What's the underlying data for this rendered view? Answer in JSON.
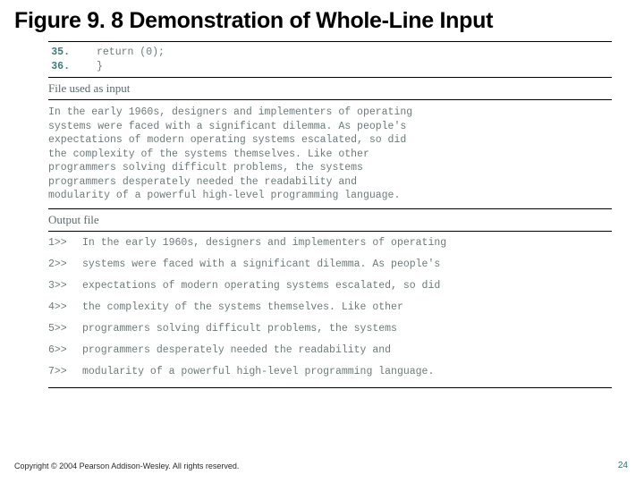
{
  "title": "Figure 9. 8  Demonstration of Whole-Line Input",
  "code": {
    "lines": [
      {
        "n": "35.",
        "text": "    return (0);"
      },
      {
        "n": "36.",
        "text": "}"
      }
    ]
  },
  "input_section": {
    "label": "File used as input",
    "lines": [
      "In the early 1960s, designers and implementers of operating",
      "systems were faced with a significant dilemma. As people's",
      "expectations of modern operating systems escalated, so did",
      "the complexity of the systems themselves. Like other",
      "programmers solving difficult problems, the systems",
      "programmers desperately needed the readability and",
      "modularity of a powerful high-level programming language."
    ]
  },
  "output_section": {
    "label": "Output file",
    "lines": [
      {
        "tag": "1>>",
        "text": "In the early 1960s, designers and implementers of operating"
      },
      {
        "tag": "2>>",
        "text": "systems were faced with a significant dilemma. As people's"
      },
      {
        "tag": "3>>",
        "text": "expectations of modern operating systems escalated, so did"
      },
      {
        "tag": "4>>",
        "text": "the complexity of the systems themselves. Like other"
      },
      {
        "tag": "5>>",
        "text": "programmers solving difficult problems, the systems"
      },
      {
        "tag": "6>>",
        "text": "programmers desperately needed the readability and"
      },
      {
        "tag": "7>>",
        "text": "modularity of a powerful high-level programming language."
      }
    ]
  },
  "footer": "Copyright © 2004 Pearson Addison-Wesley. All rights reserved.",
  "page_number": "24"
}
